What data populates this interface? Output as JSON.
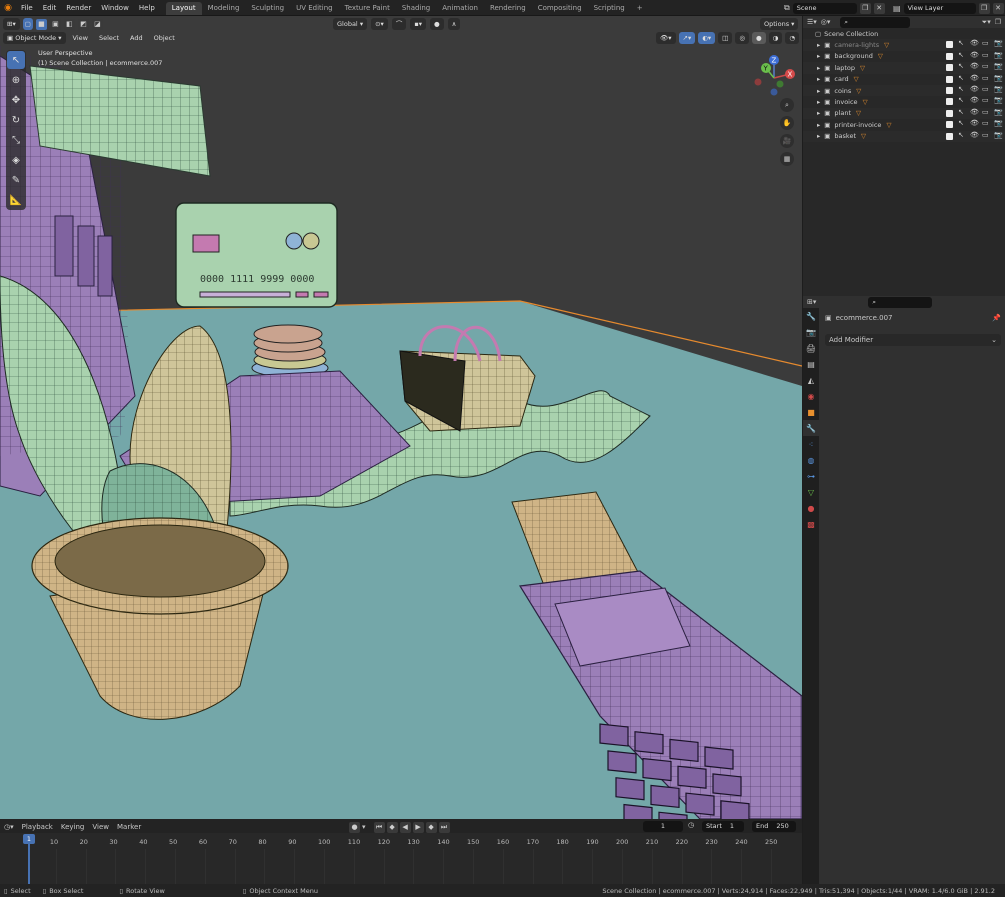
{
  "menus": [
    "File",
    "Edit",
    "Render",
    "Window",
    "Help"
  ],
  "workspaces": [
    "Layout",
    "Modeling",
    "Sculpting",
    "UV Editing",
    "Texture Paint",
    "Shading",
    "Animation",
    "Rendering",
    "Compositing",
    "Scripting"
  ],
  "active_workspace": "Layout",
  "scene": "Scene",
  "view_layer": "View Layer",
  "viewport": {
    "mode": "Object Mode",
    "menu": [
      "View",
      "Select",
      "Add",
      "Object"
    ],
    "orientation": "Global",
    "options": "Options",
    "overlay_title": "User Perspective",
    "overlay_sub": "(1) Scene Collection | ecommerce.007",
    "card_number": "0000 1111 9999 0000",
    "gizmo": {
      "z": "Z",
      "y": "Y",
      "x": "X"
    }
  },
  "outliner": {
    "root": "Scene Collection",
    "items": [
      "camera-lights",
      "background",
      "laptop",
      "card",
      "coins",
      "invoice",
      "plant",
      "printer-invoice",
      "basket"
    ]
  },
  "properties": {
    "object": "ecommerce.007",
    "add_modifier": "Add Modifier"
  },
  "timeline": {
    "menus": [
      "Playback",
      "Keying",
      "View",
      "Marker"
    ],
    "current_frame": "1",
    "start_label": "Start",
    "start": "1",
    "end_label": "End",
    "end": "250",
    "ticks": [
      "1",
      "10",
      "20",
      "30",
      "40",
      "50",
      "60",
      "70",
      "80",
      "90",
      "100",
      "110",
      "120",
      "130",
      "140",
      "150",
      "160",
      "170",
      "180",
      "190",
      "200",
      "210",
      "220",
      "230",
      "240",
      "250"
    ]
  },
  "status": {
    "select": "Select",
    "box_select": "Box Select",
    "rotate": "Rotate View",
    "context": "Object Context Menu",
    "stats": "Scene Collection | ecommerce.007 | Verts:24,914 | Faces:22,949 | Tris:51,394 | Objects:1/44 | VRAM: 1.4/6.0 GiB | 2.91.2"
  },
  "colors": {
    "accent": "#4772b3",
    "active_tab": "#3d3d3d",
    "floor": "#74a7a9",
    "mesh_green": "#a9d2ae",
    "mesh_purple": "#9b7fb8",
    "mesh_yellow": "#cfc59a"
  }
}
